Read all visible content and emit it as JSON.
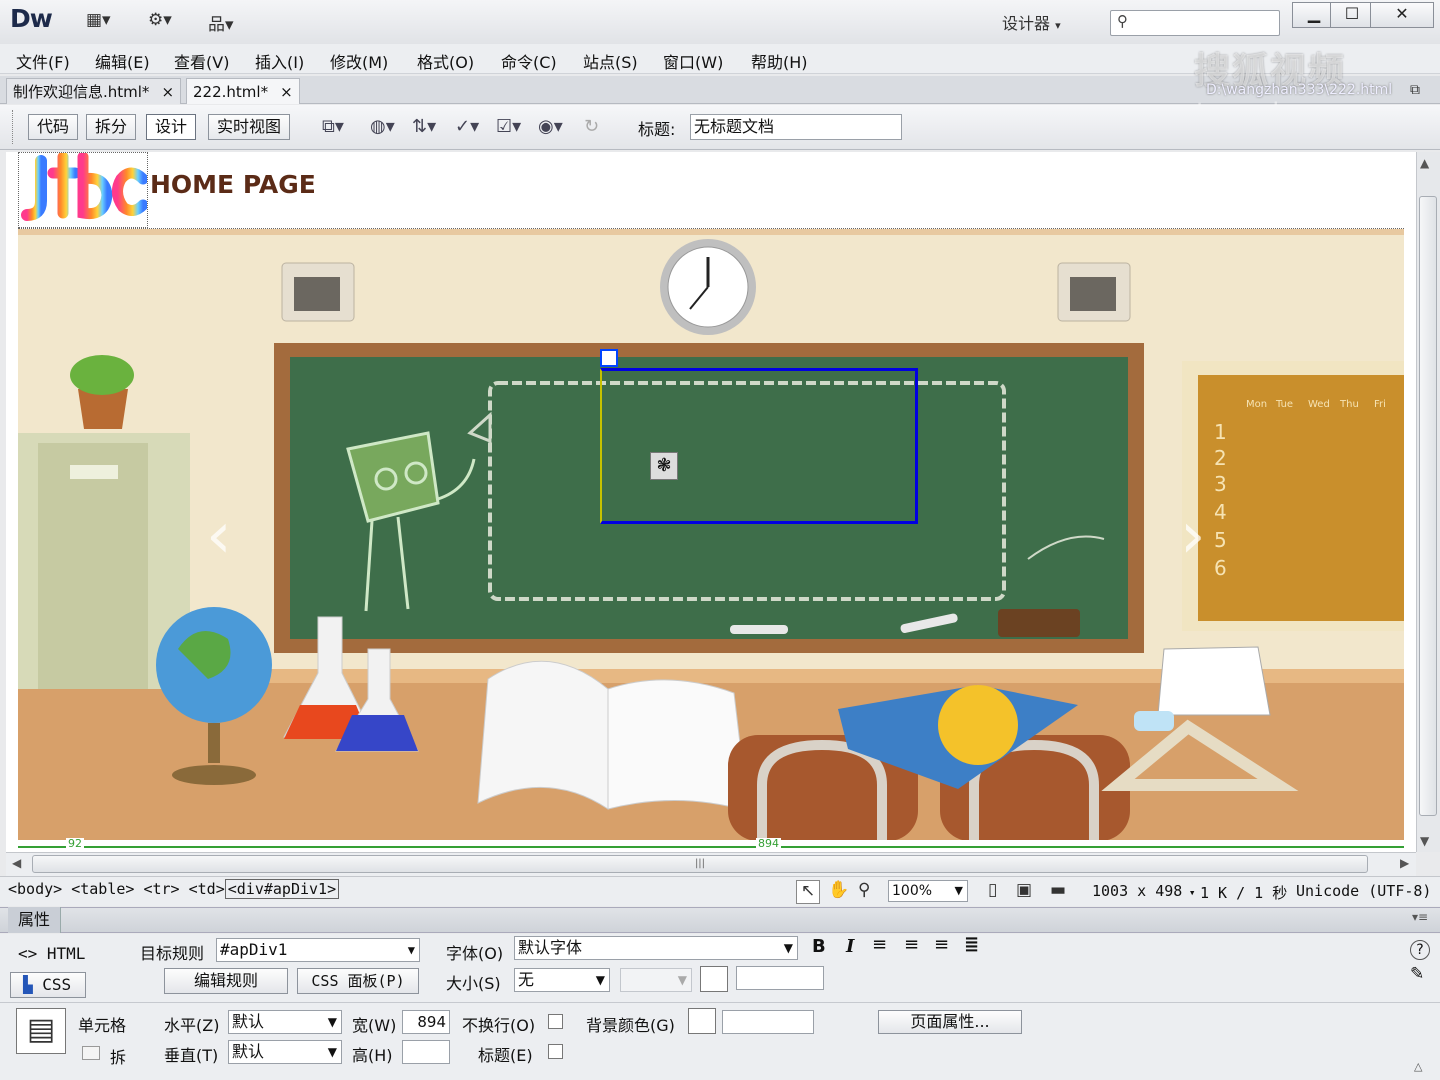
{
  "app": {
    "logo": "Dw",
    "workspace": "设计器",
    "window_buttons": [
      "minimize-icon",
      "maximize-icon",
      "close-icon"
    ]
  },
  "menu": [
    "文件(F)",
    "编辑(E)",
    "查看(V)",
    "插入(I)",
    "修改(M)",
    "格式(O)",
    "命令(C)",
    "站点(S)",
    "窗口(W)",
    "帮助(H)"
  ],
  "tabs": [
    {
      "label": "制作欢迎信息.html*",
      "active": false
    },
    {
      "label": "222.html*",
      "active": true
    }
  ],
  "file_path": "D:\\wangzhan333\\222.html",
  "watermark": {
    "line1": "搜狐视频",
    "line2": "tv.sohu.com"
  },
  "doc_toolbar": {
    "views": [
      "代码",
      "拆分",
      "设计",
      "实时视图"
    ],
    "active_view": "设计",
    "title_label": "标题:",
    "title_value": "无标题文档"
  },
  "page": {
    "heading": "HOME PAGE",
    "logo_text": "jtbc",
    "calendar_days": [
      "Mon",
      "Tue",
      "Wed",
      "Thu",
      "Fri"
    ],
    "calendar_rows": [
      "1",
      "2",
      "3",
      "4",
      "5",
      "6"
    ],
    "ruler_left": "92",
    "ruler_right": "894"
  },
  "status": {
    "tags": [
      "<body>",
      "<table>",
      "<tr>",
      "<td>",
      "<div#apDiv1>"
    ],
    "zoom": "100%",
    "dimensions": "1003 x 498",
    "size_time": "1 K / 1 秒",
    "encoding": "Unicode (UTF-8)"
  },
  "properties": {
    "title": "属性",
    "html_label": "HTML",
    "css_label": "CSS",
    "target_rule_label": "目标规则",
    "target_rule_value": "#apDiv1",
    "edit_rule": "编辑规则",
    "css_panel": "CSS 面板(P)",
    "font_label": "字体(O)",
    "font_value": "默认字体",
    "size_label": "大小(S)",
    "size_value": "无",
    "cell_label": "单元格",
    "horiz_label": "水平(Z)",
    "horiz_value": "默认",
    "vert_label": "垂直(T)",
    "vert_value": "默认",
    "width_label": "宽(W)",
    "width_value": "894",
    "height_label": "高(H)",
    "nowrap_label": "不换行(O)",
    "header_label": "标题(E)",
    "bgcolor_label": "背景颜色(G)",
    "page_props": "页面属性...",
    "merge_label": "拆"
  }
}
